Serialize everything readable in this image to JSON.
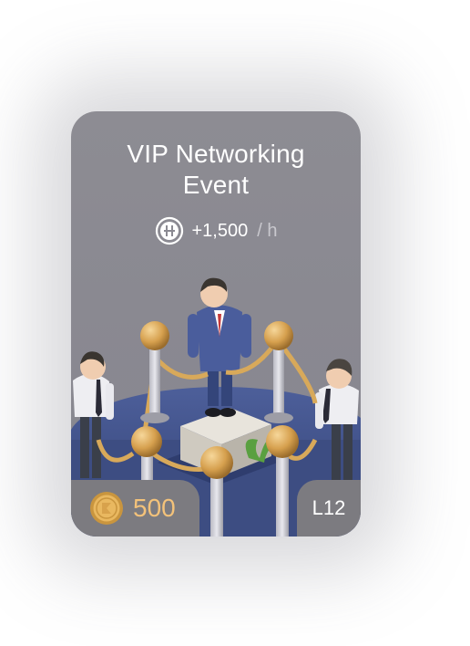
{
  "card": {
    "title_line1": "VIP Networking",
    "title_line2": "Event",
    "profit_value": "+1,500",
    "profit_unit": "/ h",
    "price": "500",
    "level": "L12",
    "icons": {
      "profit": "profit-coin-icon",
      "price": "gold-coin-icon",
      "scene": "vip-networking-illustration"
    },
    "colors": {
      "card_bg": "#8b8a92",
      "price_text": "#f3c27a",
      "tab_bg": "#7c7b80",
      "text": "#ffffff"
    }
  }
}
